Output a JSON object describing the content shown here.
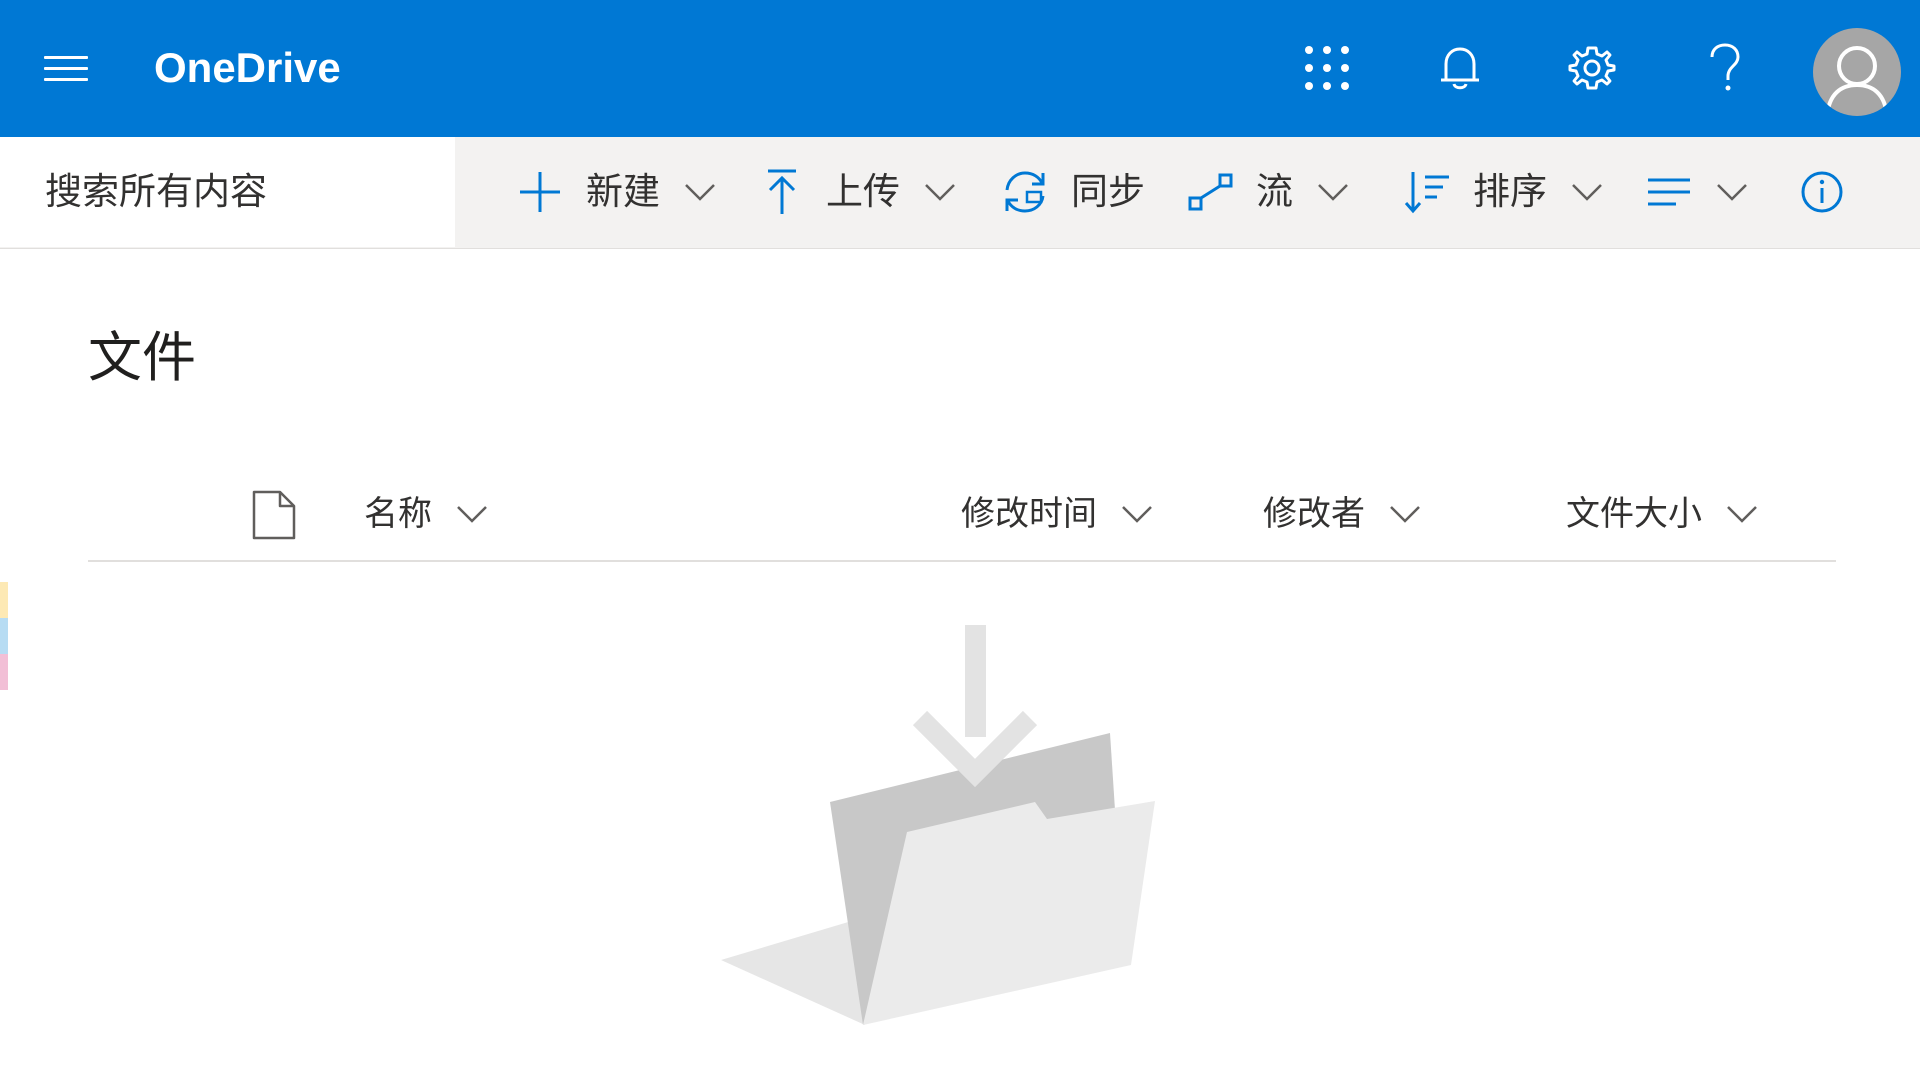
{
  "topbar": {
    "app_title": "OneDrive",
    "brand_color": "#0078d4",
    "icons": [
      "app-launcher-icon",
      "bell-icon",
      "gear-icon",
      "help-icon",
      "avatar"
    ]
  },
  "search": {
    "placeholder": "搜索所有内容"
  },
  "commands": {
    "new": "新建",
    "upload": "上传",
    "sync": "同步",
    "flow": "流",
    "sort": "排序"
  },
  "main": {
    "title": "文件",
    "columns": {
      "name": "名称",
      "modified": "修改时间",
      "modified_by": "修改者",
      "size": "文件大小"
    }
  }
}
